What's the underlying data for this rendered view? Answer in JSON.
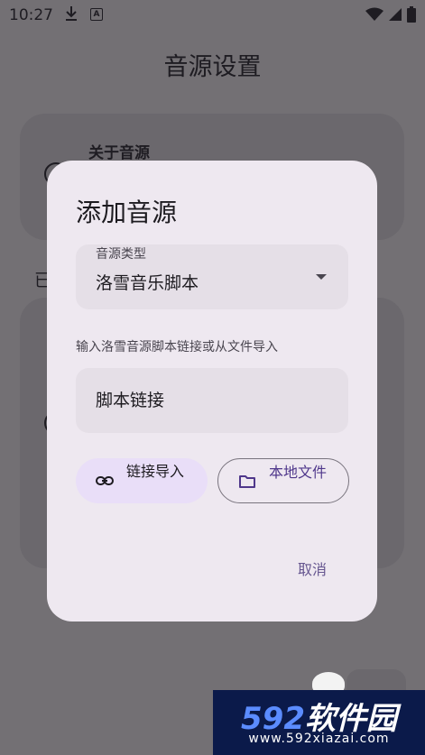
{
  "status_bar": {
    "time": "10:27"
  },
  "page": {
    "title": "音源设置"
  },
  "background": {
    "about_label": "关于音源",
    "side_text": "已"
  },
  "dialog": {
    "title": "添加音源",
    "source_type": {
      "label": "音源类型",
      "value": "洛雪音乐脚本"
    },
    "hint": "输入洛雪音源脚本链接或从文件导入",
    "link_input": {
      "placeholder": "脚本链接",
      "value": ""
    },
    "buttons": {
      "link_import": "链接导入",
      "local_file": "本地文件"
    },
    "cancel": "取消"
  },
  "watermark": {
    "number": "592",
    "brand": "软件园",
    "url": "www.592xiazai.com"
  },
  "colors": {
    "accent": "#65558f",
    "dialog_bg": "#eee8f0",
    "tonal_button": "#e9def8",
    "scrim": "#737074"
  }
}
